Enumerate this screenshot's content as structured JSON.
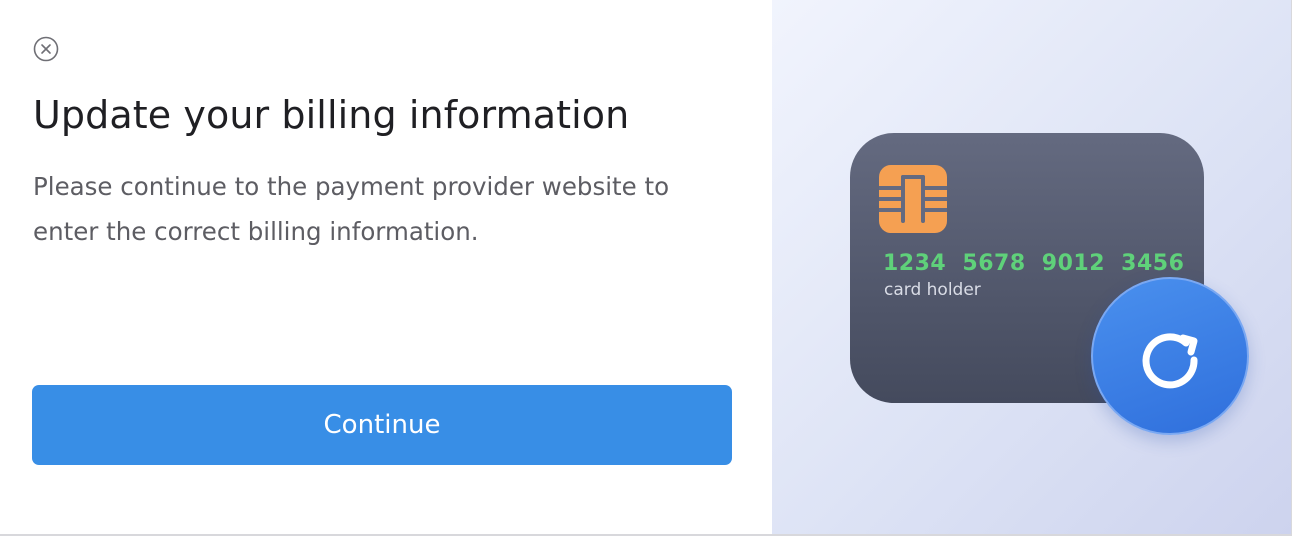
{
  "dialog": {
    "title": "Update your billing information",
    "description": "Please continue to the payment provider website to enter the correct billing information.",
    "continue_label": "Continue",
    "close_icon": "close-circle-icon"
  },
  "card": {
    "number": "1234 5678 9012 3456",
    "holder_label": "card holder",
    "chip_icon": "card-chip-icon",
    "badge_icon": "refresh-icon"
  },
  "colors": {
    "primary_button": "#388ee6",
    "card_body": "#545a6e",
    "chip": "#f5a052",
    "card_number": "#5fd17a",
    "badge": "#3b7ee6"
  }
}
